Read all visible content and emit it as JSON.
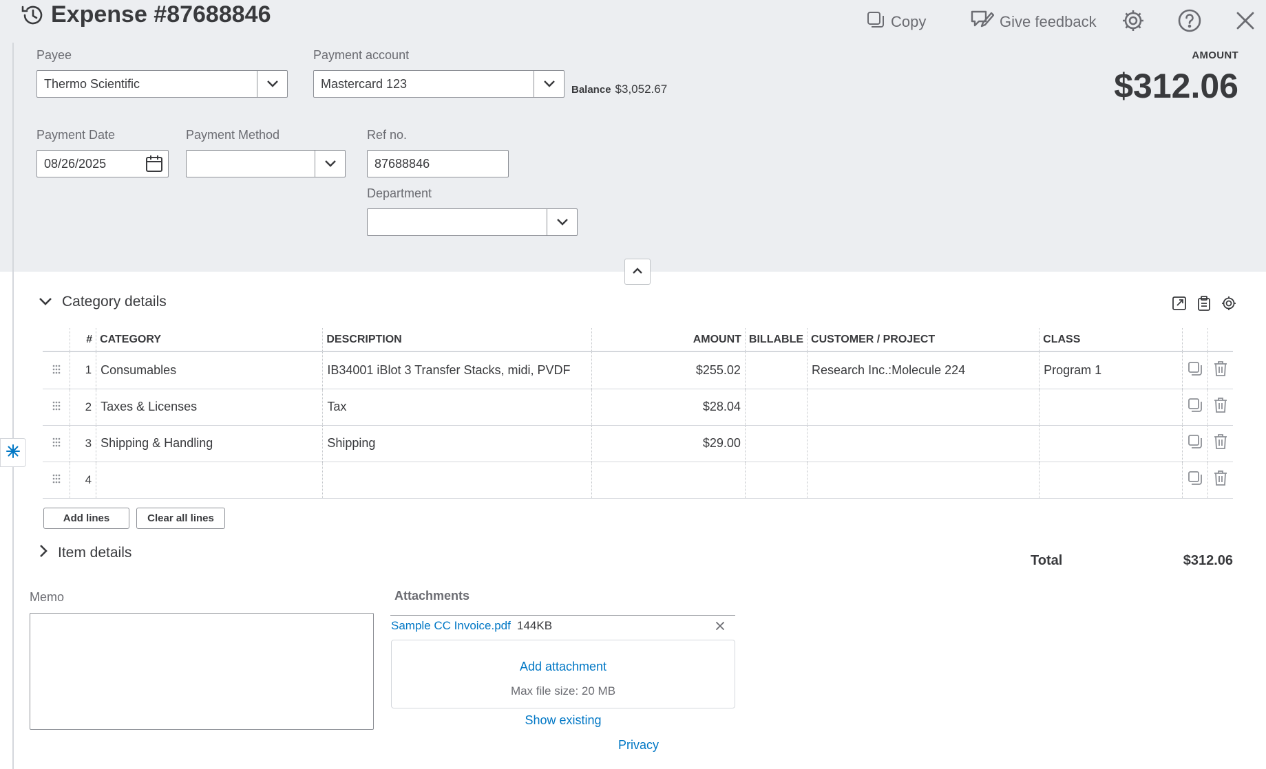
{
  "header": {
    "title": "Expense #87688846",
    "history_icon": "history-clock-icon",
    "copy_label": "Copy",
    "feedback_label": "Give feedback",
    "settings_icon": "gear-icon",
    "help_icon": "help-icon",
    "close_icon": "close-icon"
  },
  "form": {
    "payee_label": "Payee",
    "payee_value": "Thermo Scientific",
    "account_label": "Payment account",
    "account_value": "Mastercard 123",
    "balance_label": "Balance",
    "balance_value": "$3,052.67",
    "amount_label": "AMOUNT",
    "amount_value": "$312.06",
    "date_label": "Payment Date",
    "date_value": "08/26/2025",
    "method_label": "Payment Method",
    "method_value": "",
    "ref_label": "Ref no.",
    "ref_value": "87688846",
    "department_label": "Department",
    "department_value": ""
  },
  "category": {
    "section_title": "Category details",
    "columns": [
      "#",
      "CATEGORY",
      "DESCRIPTION",
      "AMOUNT",
      "BILLABLE",
      "CUSTOMER / PROJECT",
      "CLASS"
    ],
    "rows": [
      {
        "num": "1",
        "category": "Consumables",
        "description": "IB34001 iBlot 3 Transfer Stacks, midi, PVDF",
        "amount": "$255.02",
        "billable": "",
        "customer": "Research Inc.:Molecule 224",
        "class": "Program 1"
      },
      {
        "num": "2",
        "category": "Taxes & Licenses",
        "description": "Tax",
        "amount": "$28.04",
        "billable": "",
        "customer": "",
        "class": ""
      },
      {
        "num": "3",
        "category": "Shipping & Handling",
        "description": "Shipping",
        "amount": "$29.00",
        "billable": "",
        "customer": "",
        "class": ""
      },
      {
        "num": "4",
        "category": "",
        "description": "",
        "amount": "",
        "billable": "",
        "customer": "",
        "class": ""
      }
    ],
    "add_lines_label": "Add lines",
    "clear_lines_label": "Clear all lines"
  },
  "item": {
    "section_title": "Item details"
  },
  "totals": {
    "total_label": "Total",
    "total_value": "$312.06"
  },
  "memo": {
    "label": "Memo",
    "value": ""
  },
  "attachments": {
    "label": "Attachments",
    "file_name": "Sample CC Invoice.pdf",
    "file_size": "144KB",
    "add_label": "Add attachment",
    "max_size": "Max file size: 20 MB",
    "show_existing": "Show existing"
  },
  "footer": {
    "privacy": "Privacy"
  },
  "colors": {
    "band": "#eceef1",
    "link": "#0077c5",
    "text": "#393a3d",
    "muted": "#6b6c72"
  }
}
